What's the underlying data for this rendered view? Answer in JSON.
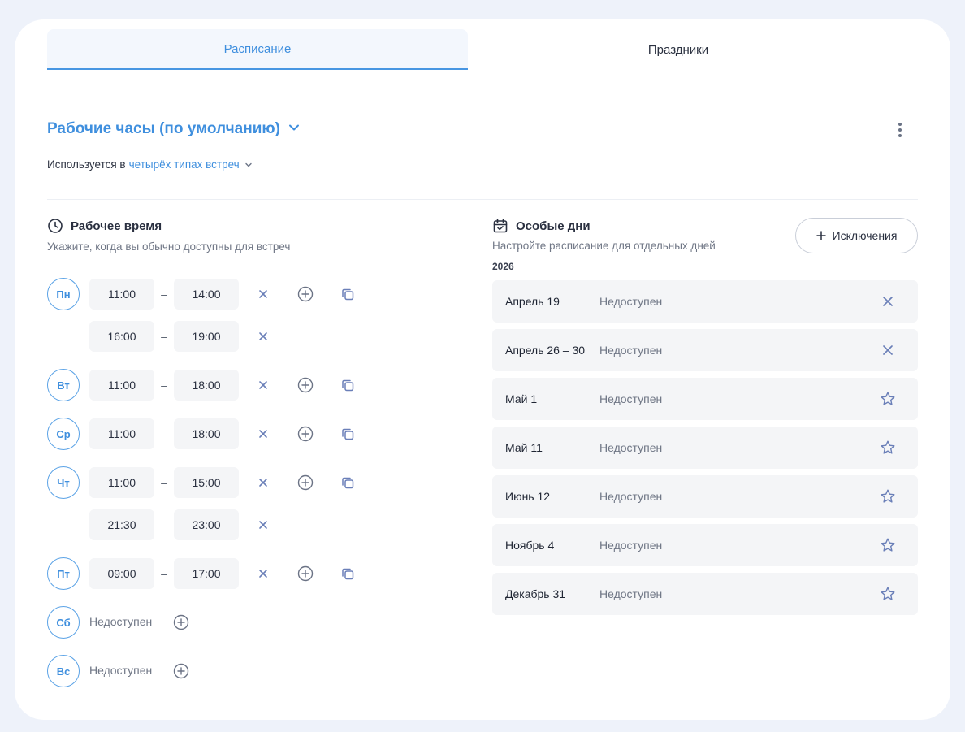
{
  "tabs": [
    {
      "label": "Расписание",
      "active": true
    },
    {
      "label": "Праздники",
      "active": false
    }
  ],
  "schedule": {
    "title": "Рабочие часы (по умолчанию)",
    "used_in_prefix": "Используется в",
    "used_in_link": "четырёх типах встреч"
  },
  "working_time": {
    "title": "Рабочее время",
    "subtitle": "Укажите, когда вы обычно доступны для встреч",
    "unavailable_label": "Недоступен",
    "days": [
      {
        "label": "Пн",
        "slots": [
          {
            "from": "11:00",
            "to": "14:00"
          },
          {
            "from": "16:00",
            "to": "19:00"
          }
        ]
      },
      {
        "label": "Вт",
        "slots": [
          {
            "from": "11:00",
            "to": "18:00"
          }
        ]
      },
      {
        "label": "Ср",
        "slots": [
          {
            "from": "11:00",
            "to": "18:00"
          }
        ]
      },
      {
        "label": "Чт",
        "slots": [
          {
            "from": "11:00",
            "to": "15:00"
          },
          {
            "from": "21:30",
            "to": "23:00"
          }
        ]
      },
      {
        "label": "Пт",
        "slots": [
          {
            "from": "09:00",
            "to": "17:00"
          }
        ]
      },
      {
        "label": "Сб",
        "slots": []
      },
      {
        "label": "Вс",
        "slots": []
      }
    ]
  },
  "special_days": {
    "title": "Особые дни",
    "subtitle": "Настройте расписание для отдельных дней",
    "add_button": "Исключения",
    "year": "2026",
    "items": [
      {
        "date": "Апрель 19",
        "status": "Недоступен",
        "action": "close"
      },
      {
        "date": "Апрель 26 – 30",
        "status": "Недоступен",
        "action": "close"
      },
      {
        "date": "Май 1",
        "status": "Недоступен",
        "action": "star"
      },
      {
        "date": "Май 11",
        "status": "Недоступен",
        "action": "star"
      },
      {
        "date": "Июнь 12",
        "status": "Недоступен",
        "action": "star"
      },
      {
        "date": "Ноябрь 4",
        "status": "Недоступен",
        "action": "star"
      },
      {
        "date": "Декабрь 31",
        "status": "Недоступен",
        "action": "star"
      }
    ]
  },
  "colors": {
    "accent": "#3f8fde",
    "row_bg": "#f4f5f7",
    "icon": "#6a7fb8"
  }
}
